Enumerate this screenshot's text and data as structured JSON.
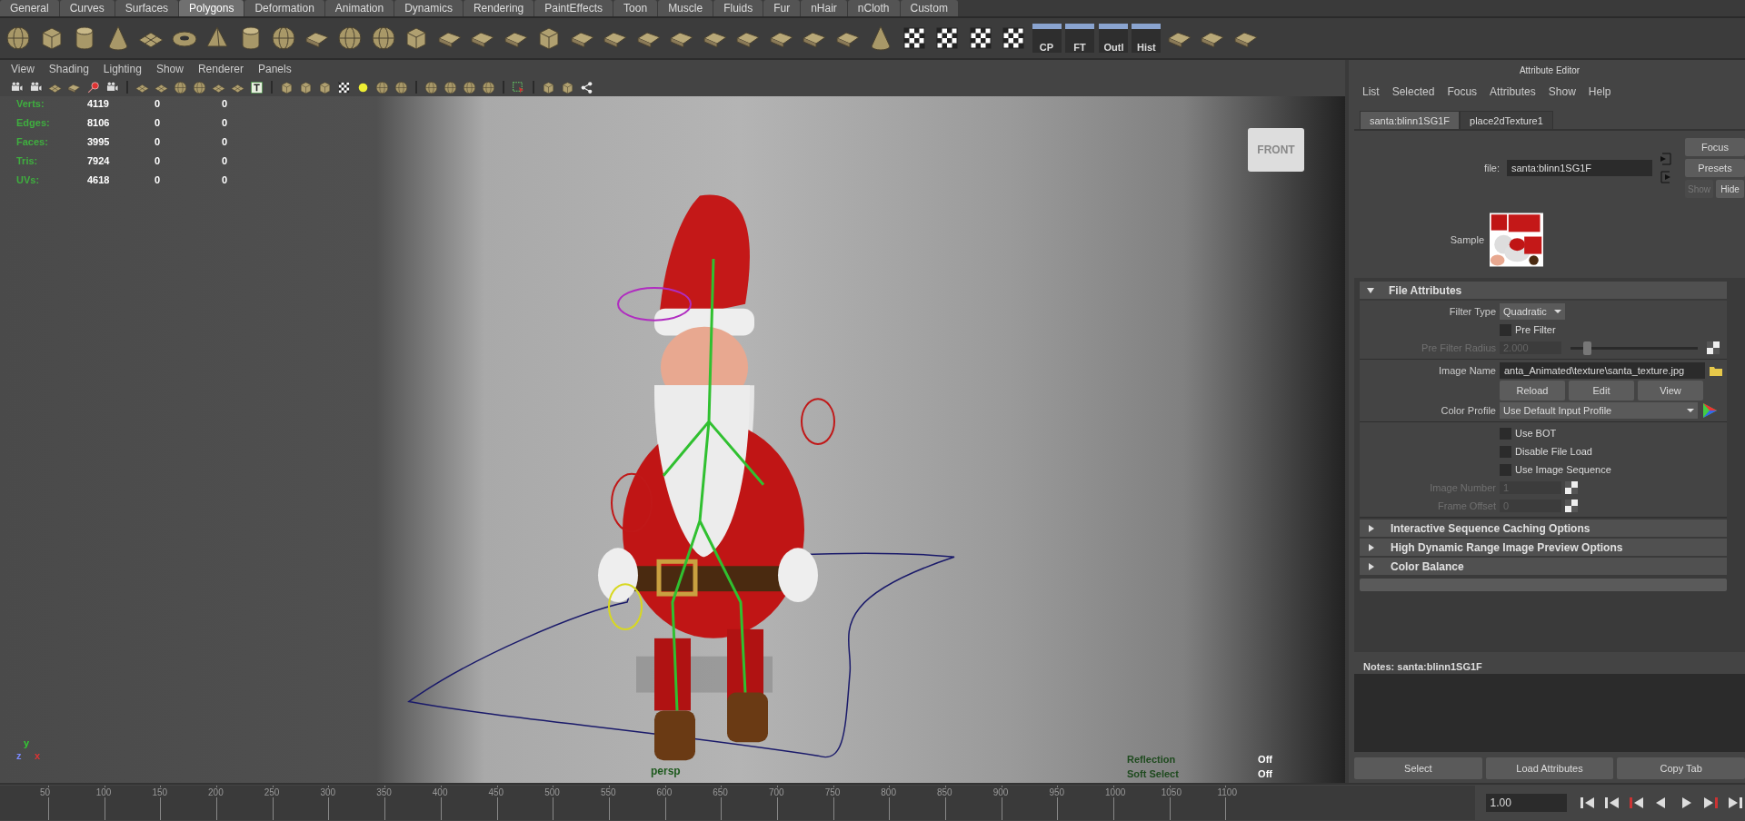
{
  "shelf_tabs": [
    {
      "label": "General",
      "selected": false
    },
    {
      "label": "Curves",
      "selected": false
    },
    {
      "label": "Surfaces",
      "selected": false
    },
    {
      "label": "Polygons",
      "selected": true
    },
    {
      "label": "Deformation",
      "selected": false
    },
    {
      "label": "Animation",
      "selected": false
    },
    {
      "label": "Dynamics",
      "selected": false
    },
    {
      "label": "Rendering",
      "selected": false
    },
    {
      "label": "PaintEffects",
      "selected": false
    },
    {
      "label": "Toon",
      "selected": false
    },
    {
      "label": "Muscle",
      "selected": false
    },
    {
      "label": "Fluids",
      "selected": false
    },
    {
      "label": "Fur",
      "selected": false
    },
    {
      "label": "nHair",
      "selected": false
    },
    {
      "label": "nCloth",
      "selected": false
    },
    {
      "label": "Custom",
      "selected": false
    }
  ],
  "shelf_text_buttons": [
    "CP",
    "FT",
    "Outl",
    "Hist"
  ],
  "viewport": {
    "menus": [
      "View",
      "Shading",
      "Lighting",
      "Show",
      "Renderer",
      "Panels"
    ],
    "stats": [
      {
        "label": "Verts:",
        "values": [
          "4119",
          "0",
          "0"
        ]
      },
      {
        "label": "Edges:",
        "values": [
          "8106",
          "0",
          "0"
        ]
      },
      {
        "label": "Faces:",
        "values": [
          "3995",
          "0",
          "0"
        ]
      },
      {
        "label": "Tris:",
        "values": [
          "7924",
          "0",
          "0"
        ]
      },
      {
        "label": "UVs:",
        "values": [
          "4618",
          "0",
          "0"
        ]
      }
    ],
    "view_cube": "FRONT",
    "camera": "persp",
    "hud_right": [
      {
        "label": "Reflection",
        "value": "Off"
      },
      {
        "label": "Soft Select",
        "value": "Off"
      }
    ],
    "axis": {
      "y": "y",
      "z": "z",
      "x": "x"
    }
  },
  "attribute_editor": {
    "title": "Attribute Editor",
    "menus": [
      "List",
      "Selected",
      "Focus",
      "Attributes",
      "Show",
      "Help"
    ],
    "tabs": [
      {
        "label": "santa:blinn1SG1F",
        "selected": true
      },
      {
        "label": "place2dTexture1",
        "selected": false
      }
    ],
    "file_label": "file:",
    "file_value": "santa:blinn1SG1F",
    "side_buttons": [
      {
        "label": "Focus",
        "disabled": false
      },
      {
        "label": "Presets",
        "disabled": false
      },
      {
        "label": "Show",
        "disabled": true
      },
      {
        "label": "Hide",
        "disabled": false
      }
    ],
    "sample_label": "Sample",
    "sections": [
      {
        "title": "File Attributes",
        "expanded": true
      },
      {
        "title": "Interactive Sequence Caching Options",
        "expanded": false
      },
      {
        "title": "High Dynamic Range Image Preview Options",
        "expanded": false
      },
      {
        "title": "Color Balance",
        "expanded": false
      }
    ],
    "file_attributes": [
      {
        "kind": "dropdown",
        "label": "Filter Type",
        "value": "Quadratic"
      },
      {
        "kind": "checkbox",
        "label": "Pre Filter",
        "checked": false
      },
      {
        "kind": "slider",
        "label": "Pre Filter Radius",
        "value": "2.000",
        "level": 0.13,
        "disabled": true
      },
      {
        "kind": "path",
        "label": "Image Name",
        "value": "anta_Animated\\texture\\santa_texture.jpg"
      },
      {
        "kind": "buttons",
        "buttons": [
          "Reload",
          "Edit",
          "View"
        ]
      },
      {
        "kind": "profile",
        "label": "Color Profile",
        "value": "Use Default Input Profile"
      },
      {
        "kind": "checkbox",
        "label": "Use BOT",
        "checked": false
      },
      {
        "kind": "checkbox",
        "label": "Disable File Load",
        "checked": false
      },
      {
        "kind": "checkbox",
        "label": "Use Image Sequence",
        "checked": false
      },
      {
        "kind": "number",
        "label": "Image Number",
        "value": "1",
        "disabled": true
      },
      {
        "kind": "number",
        "label": "Frame Offset",
        "value": "0",
        "disabled": true
      }
    ],
    "notes": "Notes:  santa:blinn1SG1F",
    "bottom_buttons": [
      "Select",
      "Load Attributes",
      "Copy Tab"
    ]
  },
  "timeline": {
    "ticks": [
      "50",
      "100",
      "150",
      "200",
      "250",
      "300",
      "350",
      "400",
      "450",
      "500",
      "550",
      "600",
      "650",
      "700",
      "750",
      "800",
      "850",
      "900",
      "950",
      "1000",
      "1050",
      "1100"
    ],
    "current_frame": "1.00"
  }
}
